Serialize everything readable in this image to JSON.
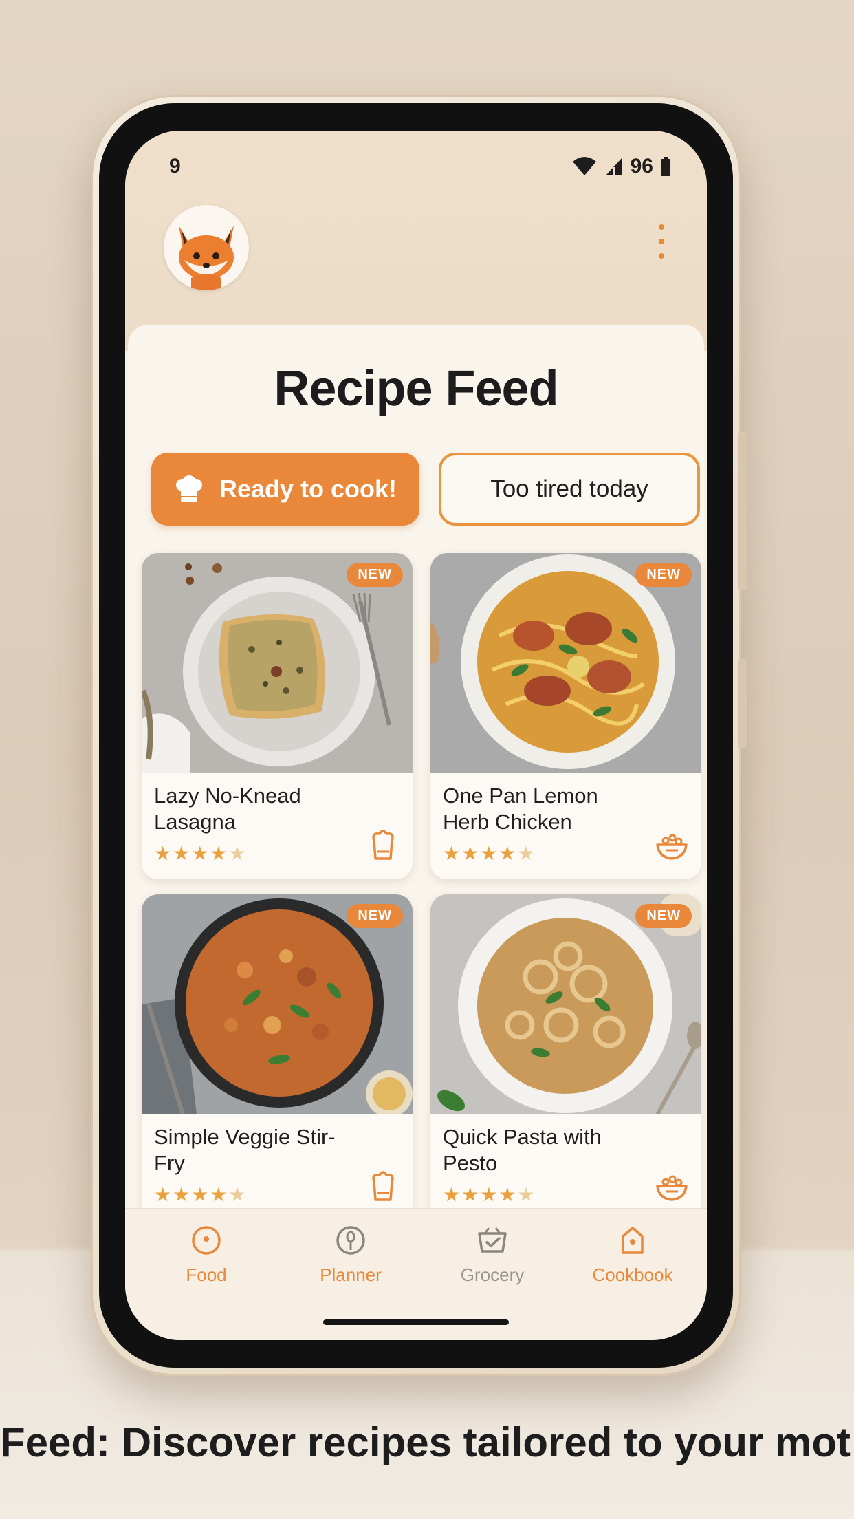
{
  "status_bar": {
    "time": "9",
    "battery": "96"
  },
  "header": {
    "title": "Recipe Feed"
  },
  "mood": {
    "ready_label": "Ready to cook!",
    "tired_label": "Too tired today"
  },
  "recipes": [
    {
      "name": "Lazy No-Knead Lasagna",
      "badge": "NEW",
      "rating": 4,
      "stars_text": "★★★★",
      "stars_empty": "★",
      "action_icon": "chef-hat-icon"
    },
    {
      "name": "One Pan Lemon Herb Chicken",
      "badge": "NEW",
      "rating": 4,
      "stars_text": "★★★★",
      "stars_empty": "★",
      "action_icon": "bowl-icon"
    },
    {
      "name": "Simple Veggie Stir-Fry",
      "badge": "NEW",
      "rating": 4,
      "stars_text": "★★★★",
      "stars_empty": "★",
      "action_icon": "chef-hat-icon"
    },
    {
      "name": "Quick Pasta with Pesto",
      "badge": "NEW",
      "rating": 4.5,
      "stars_text": "★★★★",
      "stars_empty": "★",
      "action_icon": "bowl-icon"
    }
  ],
  "nav": {
    "items": [
      {
        "label": "Food",
        "icon": "plate-icon"
      },
      {
        "label": "Planner",
        "icon": "spoon-icon"
      },
      {
        "label": "Grocery",
        "icon": "basket-icon"
      },
      {
        "label": "Cookbook",
        "icon": "book-icon"
      }
    ]
  },
  "colors": {
    "accent": "#e9883a",
    "inactive": "#9a9590",
    "background": "#f9f4ec"
  },
  "caption": "Feed: Discover recipes tailored to your mot"
}
